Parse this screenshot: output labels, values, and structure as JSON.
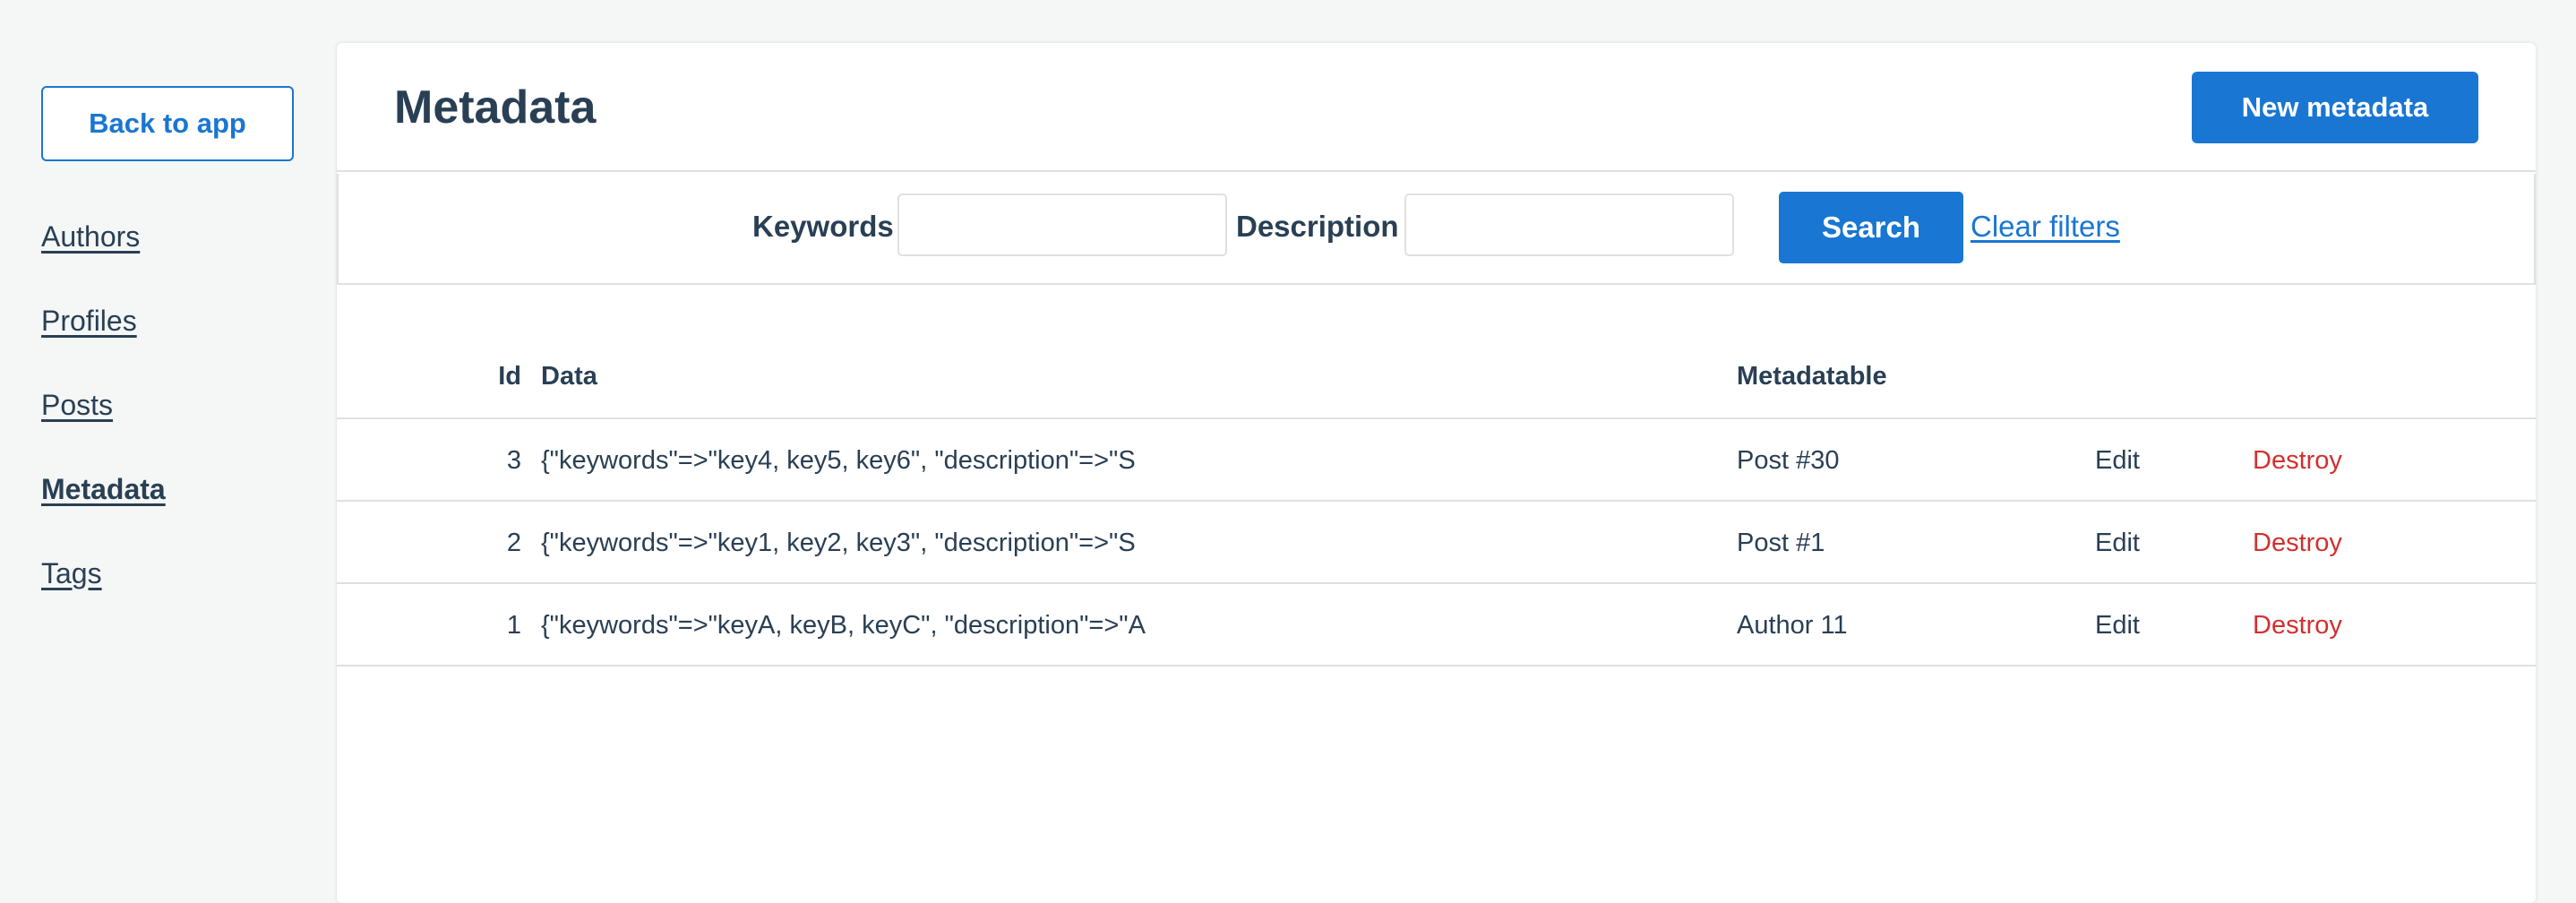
{
  "sidebar": {
    "back_label": "Back to app",
    "items": [
      {
        "label": "Authors",
        "active": false
      },
      {
        "label": "Profiles",
        "active": false
      },
      {
        "label": "Posts",
        "active": false
      },
      {
        "label": "Metadata",
        "active": true
      },
      {
        "label": "Tags",
        "active": false
      }
    ]
  },
  "header": {
    "title": "Metadata",
    "new_button_label": "New metadata"
  },
  "filters": {
    "keywords_label": "Keywords",
    "keywords_value": "",
    "description_label": "Description",
    "description_value": "",
    "search_label": "Search",
    "clear_label": "Clear filters"
  },
  "table": {
    "columns": {
      "id": "Id",
      "data": "Data",
      "metadatable": "Metadatable"
    },
    "rows": [
      {
        "id": "3",
        "data": "{\"keywords\"=>\"key4, key5, key6\", \"description\"=>\"S",
        "metadatable": "Post #30",
        "edit": "Edit",
        "destroy": "Destroy"
      },
      {
        "id": "2",
        "data": "{\"keywords\"=>\"key1, key2, key3\", \"description\"=>\"S",
        "metadatable": "Post #1",
        "edit": "Edit",
        "destroy": "Destroy"
      },
      {
        "id": "1",
        "data": "{\"keywords\"=>\"keyA, keyB, keyC\", \"description\"=>\"A",
        "metadatable": "Author 11",
        "edit": "Edit",
        "destroy": "Destroy"
      }
    ]
  },
  "colors": {
    "accent": "#1976d2",
    "text": "#293f54",
    "danger": "#d32f2f",
    "background": "#f5f7f7"
  }
}
